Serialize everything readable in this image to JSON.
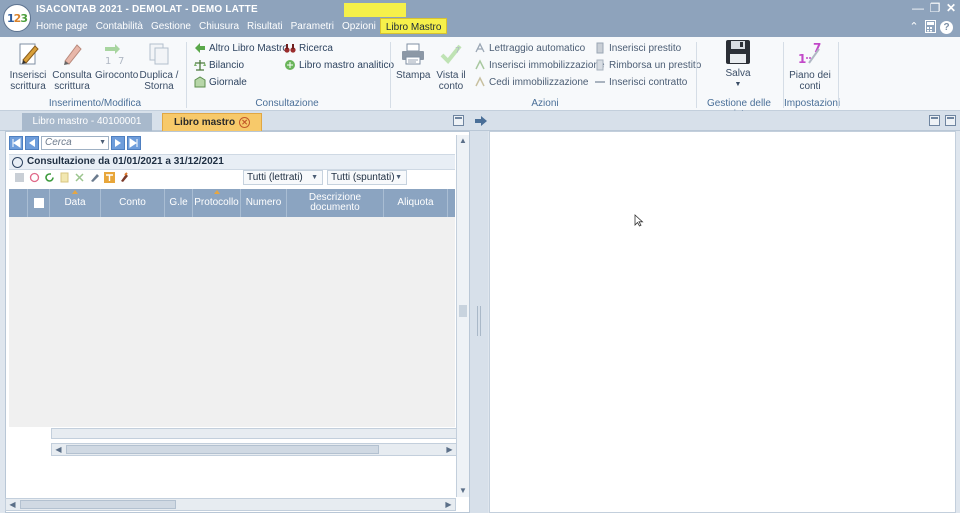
{
  "app": {
    "logo_text": [
      "1",
      "2",
      "3"
    ],
    "title": "ISACONTAB 2021 - DEMOLAT - DEMO LATTE",
    "menu": [
      "Home page",
      "Contabilità",
      "Gestione",
      "Chiusura",
      "Risultati",
      "Parametri",
      "Opzioni",
      "Libro Mastro"
    ],
    "active_menu": "Libro Mastro"
  },
  "ribbon": {
    "inserimento": {
      "group_label": "Inserimento/Modifica",
      "buttons": [
        {
          "label": "Inserisci scrittura"
        },
        {
          "label": "Consulta scrittura"
        },
        {
          "label": "Giroconto"
        },
        {
          "label": "Duplica / Storna"
        }
      ]
    },
    "consultazione": {
      "group_label": "Consultazione",
      "items": [
        "Altro Libro Mastro",
        "Bilancio",
        "Giornale",
        "Ricerca",
        "Libro mastro analitico"
      ]
    },
    "azioni": {
      "group_label": "Azioni",
      "big": [
        "Stampa",
        "Vista il conto"
      ],
      "items": [
        "Lettraggio automatico",
        "Inserisci immobilizzazione",
        "Cedi immobilizzazione",
        "Inserisci prestito",
        "Rimborsa un prestito",
        "Inserisci contratto"
      ]
    },
    "viste": {
      "group_label": "Gestione delle viste",
      "save_label": "Salva"
    },
    "impostazioni": {
      "group_label": "Impostazioni",
      "piano_label": "Piano dei conti"
    }
  },
  "tabs": [
    {
      "label": "Libro mastro - 40100001",
      "active": false
    },
    {
      "label": "Libro mastro",
      "active": true
    }
  ],
  "left_panel": {
    "search_placeholder": "Cerca",
    "period_label": "Consultazione da 01/01/2021 a 31/12/2021",
    "filter_lettrati": "Tutti (lettrati)",
    "filter_spuntati": "Tutti (spuntati)",
    "columns": [
      "Data",
      "Conto",
      "G.le",
      "Protocollo",
      "Numero",
      "Descrizione documento",
      "Aliquota"
    ]
  },
  "colors": {
    "titlebar": "#8ea3bc",
    "active_menu": "#f6f04a",
    "active_tab": "#f7c96a",
    "grid_header": "#8ba4c1"
  }
}
